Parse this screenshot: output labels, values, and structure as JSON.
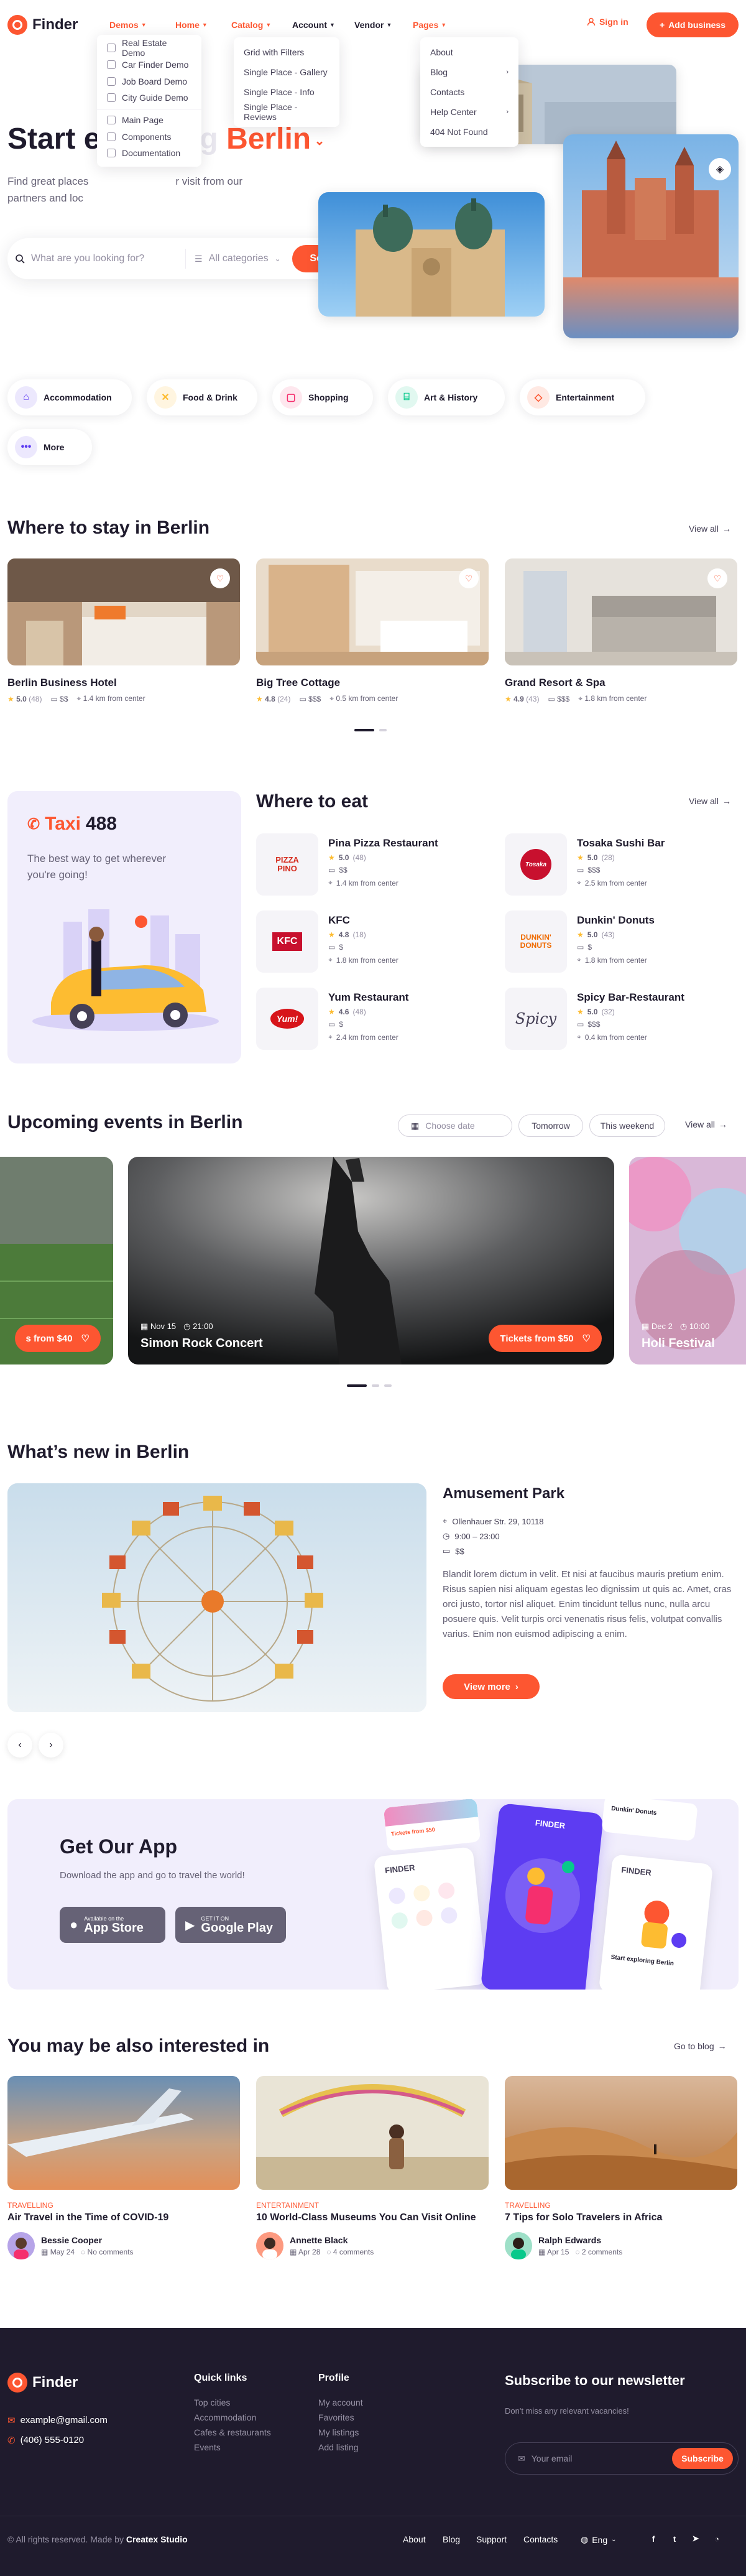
{
  "brand": {
    "name": "Finder",
    "accent": "#fd5631",
    "dark": "#1f1b2d"
  },
  "nav": {
    "items": [
      {
        "label": "Demos",
        "active": true
      },
      {
        "label": "Home",
        "active": true
      },
      {
        "label": "Catalog",
        "active": true
      },
      {
        "label": "Account",
        "active": false
      },
      {
        "label": "Vendor",
        "active": false
      },
      {
        "label": "Pages",
        "active": true
      }
    ],
    "sign_in": "Sign in",
    "add_business": "Add business"
  },
  "demos_menu": [
    "Real Estate Demo",
    "Car Finder Demo",
    "Job Board Demo",
    "City Guide Demo",
    "Main Page",
    "Components",
    "Documentation"
  ],
  "catalog_menu": [
    "Grid with Filters",
    "Single Place - Gallery",
    "Single Place - Info",
    "Single Place - Reviews"
  ],
  "pages_menu": [
    "About",
    "Blog",
    "Contacts",
    "Help Center",
    "404 Not Found"
  ],
  "hero": {
    "title_start": "Start e",
    "title_obscured": "xploring",
    "title_city": "Berlin",
    "subtitle_start": "Find great places",
    "subtitle_end": "r visit from our",
    "subtitle_line2": "partners and loc",
    "search_placeholder": "What are you looking for?",
    "categories_placeholder": "All categories",
    "search_button": "Search"
  },
  "categories": [
    {
      "label": "Accommodation",
      "icon": "bed-icon",
      "color": "#5d3cf2"
    },
    {
      "label": "Food & Drink",
      "icon": "food-icon",
      "color": "#fdbc31"
    },
    {
      "label": "Shopping",
      "icon": "bag-icon",
      "color": "#f52f6e"
    },
    {
      "label": "Art & History",
      "icon": "museum-icon",
      "color": "#07c98b"
    },
    {
      "label": "Entertainment",
      "icon": "ticket-icon",
      "color": "#fd5631"
    },
    {
      "label": "More",
      "icon": "more-icon",
      "color": "#5d3cf2"
    }
  ],
  "stay": {
    "title": "Where to stay in Berlin",
    "view_all": "View all",
    "items": [
      {
        "name": "Berlin Business Hotel",
        "rating": "5.0",
        "reviews": "(48)",
        "price": "$$",
        "distance": "1.4 km from center"
      },
      {
        "name": "Big Tree Cottage",
        "rating": "4.8",
        "reviews": "(24)",
        "price": "$$$",
        "distance": "0.5 km from center"
      },
      {
        "name": "Grand Resort & Spa",
        "rating": "4.9",
        "reviews": "(43)",
        "price": "$$$",
        "distance": "1.8 km from center"
      }
    ]
  },
  "taxi": {
    "brand": "Taxi",
    "number": "488",
    "text": "The best way to get wherever you're going!"
  },
  "eat": {
    "title": "Where to eat",
    "view_all": "View all",
    "items": [
      {
        "name": "Pina Pizza Restaurant",
        "rating": "5.0",
        "reviews": "(48)",
        "price": "$$",
        "distance": "1.4 km from center",
        "logo": "PIZZA PINO",
        "logo_color": "#d52b1e"
      },
      {
        "name": "Tosaka Sushi Bar",
        "rating": "5.0",
        "reviews": "(28)",
        "price": "$$$",
        "distance": "2.5 km from center",
        "logo": "Tosaka",
        "logo_color": "#c8102e"
      },
      {
        "name": "KFC",
        "rating": "4.8",
        "reviews": "(18)",
        "price": "$",
        "distance": "1.8 km from center",
        "logo": "KFC",
        "logo_color": "#c8102e"
      },
      {
        "name": "Dunkin' Donuts",
        "rating": "5.0",
        "reviews": "(43)",
        "price": "$",
        "distance": "1.8 km from center",
        "logo": "DUNKIN' DONUTS",
        "logo_color": "#ef6a00"
      },
      {
        "name": "Yum Restaurant",
        "rating": "4.6",
        "reviews": "(48)",
        "price": "$",
        "distance": "2.4 km from center",
        "logo": "Yum!",
        "logo_color": "#d7141a"
      },
      {
        "name": "Spicy Bar-Restaurant",
        "rating": "5.0",
        "reviews": "(32)",
        "price": "$$$",
        "distance": "0.4 km from center",
        "logo": "Spicy",
        "logo_color": "#454056"
      }
    ]
  },
  "events": {
    "title": "Upcoming events in Berlin",
    "choose_date": "Choose date",
    "tomorrow": "Tomorrow",
    "weekend": "This weekend",
    "view_all": "View all",
    "items": [
      {
        "name": "",
        "date": "",
        "time": "",
        "price": "s from $40"
      },
      {
        "name": "Simon Rock Concert",
        "date": "Nov 15",
        "time": "21:00",
        "price": "Tickets from $50"
      },
      {
        "name": "Holi Festival",
        "date": "Dec 2",
        "time": "10:00",
        "price": ""
      }
    ]
  },
  "new": {
    "title": "What’s new in Berlin",
    "place": "Amusement Park",
    "address": "Ollenhauer Str. 29, 10118",
    "hours": "9:00 – 23:00",
    "price": "$$",
    "description": "Blandit lorem dictum in velit. Et nisi at faucibus mauris pretium enim. Risus sapien nisi aliquam egestas leo dignissim ut quis ac. Amet, cras orci justo, tortor nisl aliquet. Enim tincidunt tellus nunc, nulla arcu posuere quis. Velit turpis orci venenatis risus felis, volutpat convallis varius. Enim non euismod adipiscing a enim.",
    "button": "View more"
  },
  "app": {
    "title": "Get Our App",
    "subtitle": "Download the app and go to travel the world!",
    "appstore_small": "Available on the",
    "appstore_big": "App Store",
    "play_small": "GET IT ON",
    "play_big": "Google Play",
    "mock_finder": "FINDER",
    "mock_tickets": "Tickets from $50",
    "mock_dunkin": "Dunkin' Donuts",
    "mock_start": "Start exploring Berlin"
  },
  "blog": {
    "title": "You may be also interested in",
    "go_to_blog": "Go to blog",
    "posts": [
      {
        "category": "TRAVELLING",
        "title": "Air Travel in the Time of COVID-19",
        "author": "Bessie Cooper",
        "date": "May 24",
        "comments": "No comments"
      },
      {
        "category": "ENTERTAINMENT",
        "title": "10 World-Class Museums You Can Visit Online",
        "author": "Annette Black",
        "date": "Apr 28",
        "comments": "4 comments"
      },
      {
        "category": "TRAVELLING",
        "title": "7 Tips for Solo Travelers in Africa",
        "author": "Ralph Edwards",
        "date": "Apr 15",
        "comments": "2 comments"
      }
    ]
  },
  "footer": {
    "email": "example@gmail.com",
    "phone": "(406) 555-0120",
    "quick_links_title": "Quick links",
    "quick_links": [
      "Top cities",
      "Accommodation",
      "Cafes & restaurants",
      "Events"
    ],
    "profile_title": "Profile",
    "profile_links": [
      "My account",
      "Favorites",
      "My listings",
      "Add listing"
    ],
    "newsletter_title": "Subscribe to our newsletter",
    "newsletter_sub": "Don't miss any relevant vacancies!",
    "email_placeholder": "Your email",
    "subscribe": "Subscribe",
    "copyright_prefix": "© All rights reserved. Made by",
    "copyright_author": "Createx Studio",
    "bottom_links": [
      "About",
      "Blog",
      "Support",
      "Contacts"
    ],
    "language": "Eng",
    "social": [
      "facebook-icon",
      "twitter-icon",
      "telegram-icon",
      "messenger-icon"
    ]
  }
}
